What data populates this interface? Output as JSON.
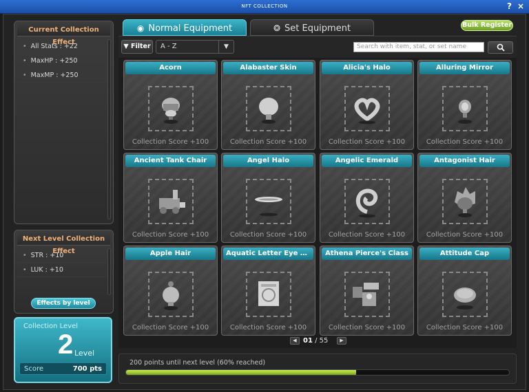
{
  "window": {
    "title": "NFT COLLECTION"
  },
  "left": {
    "current_title": "Current Collection Effect",
    "current_effects": [
      "All Stats : +22",
      "MaxHP : +250",
      "MaxMP : +250"
    ],
    "next_title": "Next Level Collection Effect",
    "next_effects": [
      "STR : +10",
      "LUK : +10"
    ],
    "effects_button": "Effects by level",
    "level": {
      "label": "Collection Level",
      "value": "2",
      "word": "Level",
      "score_label": "Score",
      "score_value": "700 pts"
    }
  },
  "tabs": [
    {
      "label": "Normal Equipment",
      "icon": "radio-selected-icon"
    },
    {
      "label": "Set Equipment",
      "icon": "set-icon"
    }
  ],
  "bulk_register": "Bulk Register",
  "toolbar": {
    "filter_label": "Filter",
    "sort_value": "A - Z",
    "search_placeholder": "Search with item, stat, or set name"
  },
  "items": [
    {
      "name": "Acorn",
      "score": "Collection Score +100",
      "icon": "acorn-icon"
    },
    {
      "name": "Alabaster Skin",
      "score": "Collection Score +100",
      "icon": "head-icon"
    },
    {
      "name": "Alicia's Halo",
      "score": "Collection Score +100",
      "icon": "halo-heart-icon"
    },
    {
      "name": "Alluring Mirror",
      "score": "Collection Score +100",
      "icon": "mirror-icon"
    },
    {
      "name": "Ancient Tank Chair",
      "score": "Collection Score +100",
      "icon": "tank-icon"
    },
    {
      "name": "Angel Halo",
      "score": "Collection Score +100",
      "icon": "halo-icon"
    },
    {
      "name": "Angelic Emerald",
      "score": "Collection Score +100",
      "icon": "emerald-icon"
    },
    {
      "name": "Antagonist Hair",
      "score": "Collection Score +100",
      "icon": "hair-icon"
    },
    {
      "name": "Apple Hair",
      "score": "Collection Score +100",
      "icon": "apple-hair-icon"
    },
    {
      "name": "Aquatic Letter Eye Acc...",
      "score": "Collection Score +100",
      "icon": "eye-accessory-icon"
    },
    {
      "name": "Athena Pierce's Class",
      "score": "Collection Score +100",
      "icon": "class-icon"
    },
    {
      "name": "Attitude Cap",
      "score": "Collection Score +100",
      "icon": "cap-icon"
    }
  ],
  "pager": {
    "current": "01",
    "separator": "/",
    "total": "55"
  },
  "progress": {
    "text": "200 points until next level (60% reached)",
    "fraction": 0.6
  },
  "colors": {
    "accent": "#2aa3b8",
    "progress": "#a6d33a",
    "bulk": "#8fc23a",
    "title_accent": "#f0b37a"
  }
}
